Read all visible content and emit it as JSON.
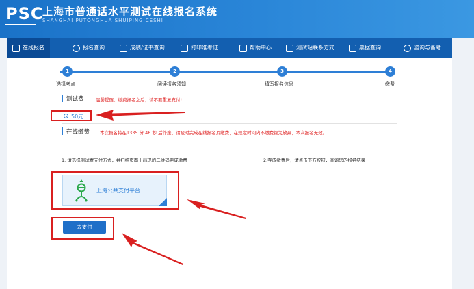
{
  "header": {
    "logo": "PSC",
    "title": "上海市普通话水平测试在线报名系统",
    "subtitle": "SHANGHAI PUTONGHUA SHUIPING CESHI"
  },
  "nav": {
    "items": [
      {
        "label": "在线报名",
        "icon": "edit-icon"
      },
      {
        "label": "报名查询",
        "icon": "search-icon"
      },
      {
        "label": "成绩/证书查询",
        "icon": "certificate-search-icon"
      },
      {
        "label": "打印准考证",
        "icon": "printer-icon"
      },
      {
        "label": "帮助中心",
        "icon": "help-icon"
      },
      {
        "label": "测试站联系方式",
        "icon": "contact-icon"
      },
      {
        "label": "票据查询",
        "icon": "receipt-search-icon"
      },
      {
        "label": "咨询与备考",
        "icon": "chat-icon"
      }
    ]
  },
  "steps": [
    {
      "num": "1",
      "label": "选择考点"
    },
    {
      "num": "2",
      "label": "阅读报名须知"
    },
    {
      "num": "3",
      "label": "填写报名信息"
    },
    {
      "num": "4",
      "label": "缴费"
    }
  ],
  "fee": {
    "title": "测试费",
    "warning": "温馨提醒：缴费报名之后，请不要重复支付!",
    "option": "50元"
  },
  "online_pay": {
    "title": "在线缴费",
    "notice": "本次报名将在1335 分 46 秒 后作废，请及时完成在线报名及缴费，在规定时间内不缴费视为放弃，本次报名无效。",
    "instruction_1": "1. 请选择测试费支付方式，并扫描页面上出现的二维码完成缴费",
    "instruction_2": "2.完成缴费后，请点击下方按钮，查询您的报名结果",
    "platform": "上海公共支付平台 ...",
    "pay_button": "去支付"
  },
  "colors": {
    "primary": "#2e7fd6",
    "nav": "#135fb0",
    "nav_active": "#0a4a95",
    "warning": "#e02a2a",
    "annotation": "#d92020"
  }
}
